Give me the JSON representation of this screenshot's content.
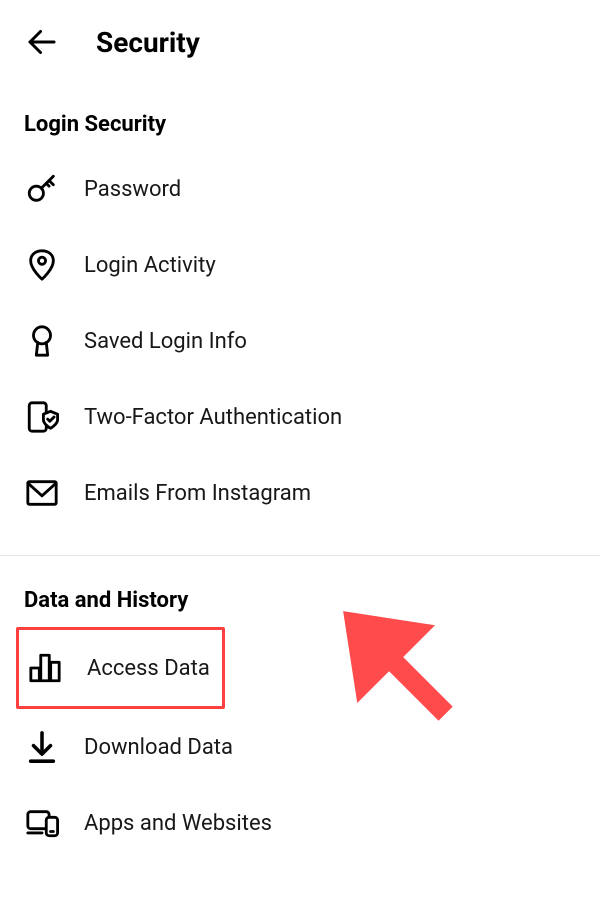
{
  "header": {
    "title": "Security"
  },
  "sections": [
    {
      "title": "Login Security",
      "items": [
        {
          "label": "Password",
          "icon": "key-icon"
        },
        {
          "label": "Login Activity",
          "icon": "location-pin-icon"
        },
        {
          "label": "Saved Login Info",
          "icon": "keyhole-icon"
        },
        {
          "label": "Two-Factor Authentication",
          "icon": "shield-device-icon"
        },
        {
          "label": "Emails From Instagram",
          "icon": "mail-icon"
        }
      ]
    },
    {
      "title": "Data and History",
      "items": [
        {
          "label": "Access Data",
          "icon": "bar-chart-icon",
          "highlighted": true
        },
        {
          "label": "Download Data",
          "icon": "download-icon"
        },
        {
          "label": "Apps and Websites",
          "icon": "devices-icon"
        }
      ]
    }
  ],
  "annotation": {
    "color": "#ff4b4b"
  }
}
